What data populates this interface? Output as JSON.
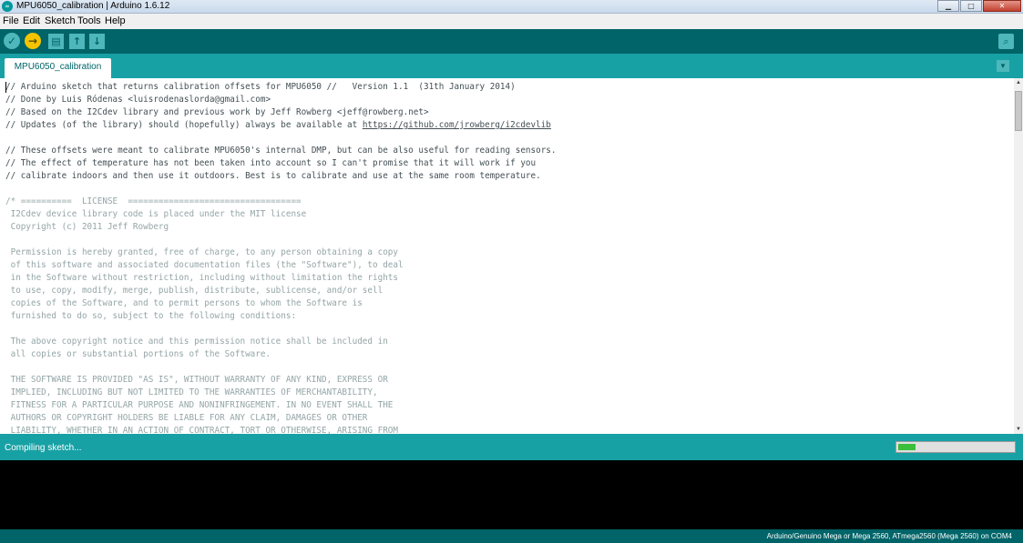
{
  "window": {
    "title": "MPU6050_calibration | Arduino 1.6.12",
    "app_icon": "arduino-logo-icon",
    "controls": [
      "minimize-icon",
      "maximize-icon",
      "close-icon"
    ]
  },
  "menu": [
    "File",
    "Edit",
    "Sketch",
    "Tools",
    "Help"
  ],
  "toolbar": {
    "buttons": [
      {
        "name": "verify",
        "icon": "check-icon",
        "glyph": "✓"
      },
      {
        "name": "upload",
        "icon": "arrow-right-icon",
        "glyph": "→"
      },
      {
        "name": "new",
        "icon": "new-file-icon",
        "glyph": "▤"
      },
      {
        "name": "open",
        "icon": "arrow-up-icon",
        "glyph": "↑"
      },
      {
        "name": "save",
        "icon": "arrow-down-icon",
        "glyph": "↓"
      }
    ],
    "serial_monitor_icon": "magnifier-icon"
  },
  "tabs": [
    {
      "label": "MPU6050_calibration",
      "active": true
    }
  ],
  "editor": {
    "lines": [
      "// Arduino sketch that returns calibration offsets for MPU6050 //   Version 1.1  (31th January 2014)",
      "// Done by Luis Ródenas <luisrodenaslorda@gmail.com>",
      "// Based on the I2Cdev library and previous work by Jeff Rowberg <jeff@rowberg.net>",
      "// Updates (of the library) should (hopefully) always be available at ",
      "",
      "// These offsets were meant to calibrate MPU6050's internal DMP, but can be also useful for reading sensors.",
      "// The effect of temperature has not been taken into account so I can't promise that it will work if you",
      "// calibrate indoors and then use it outdoors. Best is to calibrate and use at the same room temperature.",
      "",
      "/* ==========  LICENSE  ==================================",
      " I2Cdev device library code is placed under the MIT license",
      " Copyright (c) 2011 Jeff Rowberg",
      "",
      " Permission is hereby granted, free of charge, to any person obtaining a copy",
      " of this software and associated documentation files (the \"Software\"), to deal",
      " in the Software without restriction, including without limitation the rights",
      " to use, copy, modify, merge, publish, distribute, sublicense, and/or sell",
      " copies of the Software, and to permit persons to whom the Software is",
      " furnished to do so, subject to the following conditions:",
      "",
      " The above copyright notice and this permission notice shall be included in",
      " all copies or substantial portions of the Software.",
      "",
      " THE SOFTWARE IS PROVIDED \"AS IS\", WITHOUT WARRANTY OF ANY KIND, EXPRESS OR",
      " IMPLIED, INCLUDING BUT NOT LIMITED TO THE WARRANTIES OF MERCHANTABILITY,",
      " FITNESS FOR A PARTICULAR PURPOSE AND NONINFRINGEMENT. IN NO EVENT SHALL THE",
      " AUTHORS OR COPYRIGHT HOLDERS BE LIABLE FOR ANY CLAIM, DAMAGES OR OTHER",
      " LIABILITY, WHETHER IN AN ACTION OF CONTRACT, TORT OR OTHERWISE, ARISING FROM"
    ],
    "link": "https://github.com/jrowberg/i2cdevlib"
  },
  "status": {
    "message": "Compiling sketch...",
    "progress": 0.15
  },
  "footer": {
    "board": "Arduino/Genuino Mega or Mega 2560, ATmega2560 (Mega 2560) on COM4"
  },
  "colors": {
    "toolbar": "#006468",
    "teal": "#17a1a5",
    "button": "#4db7bb",
    "active_button": "#f4c400",
    "comment": "#434f54",
    "block_comment": "#95a5a6"
  }
}
